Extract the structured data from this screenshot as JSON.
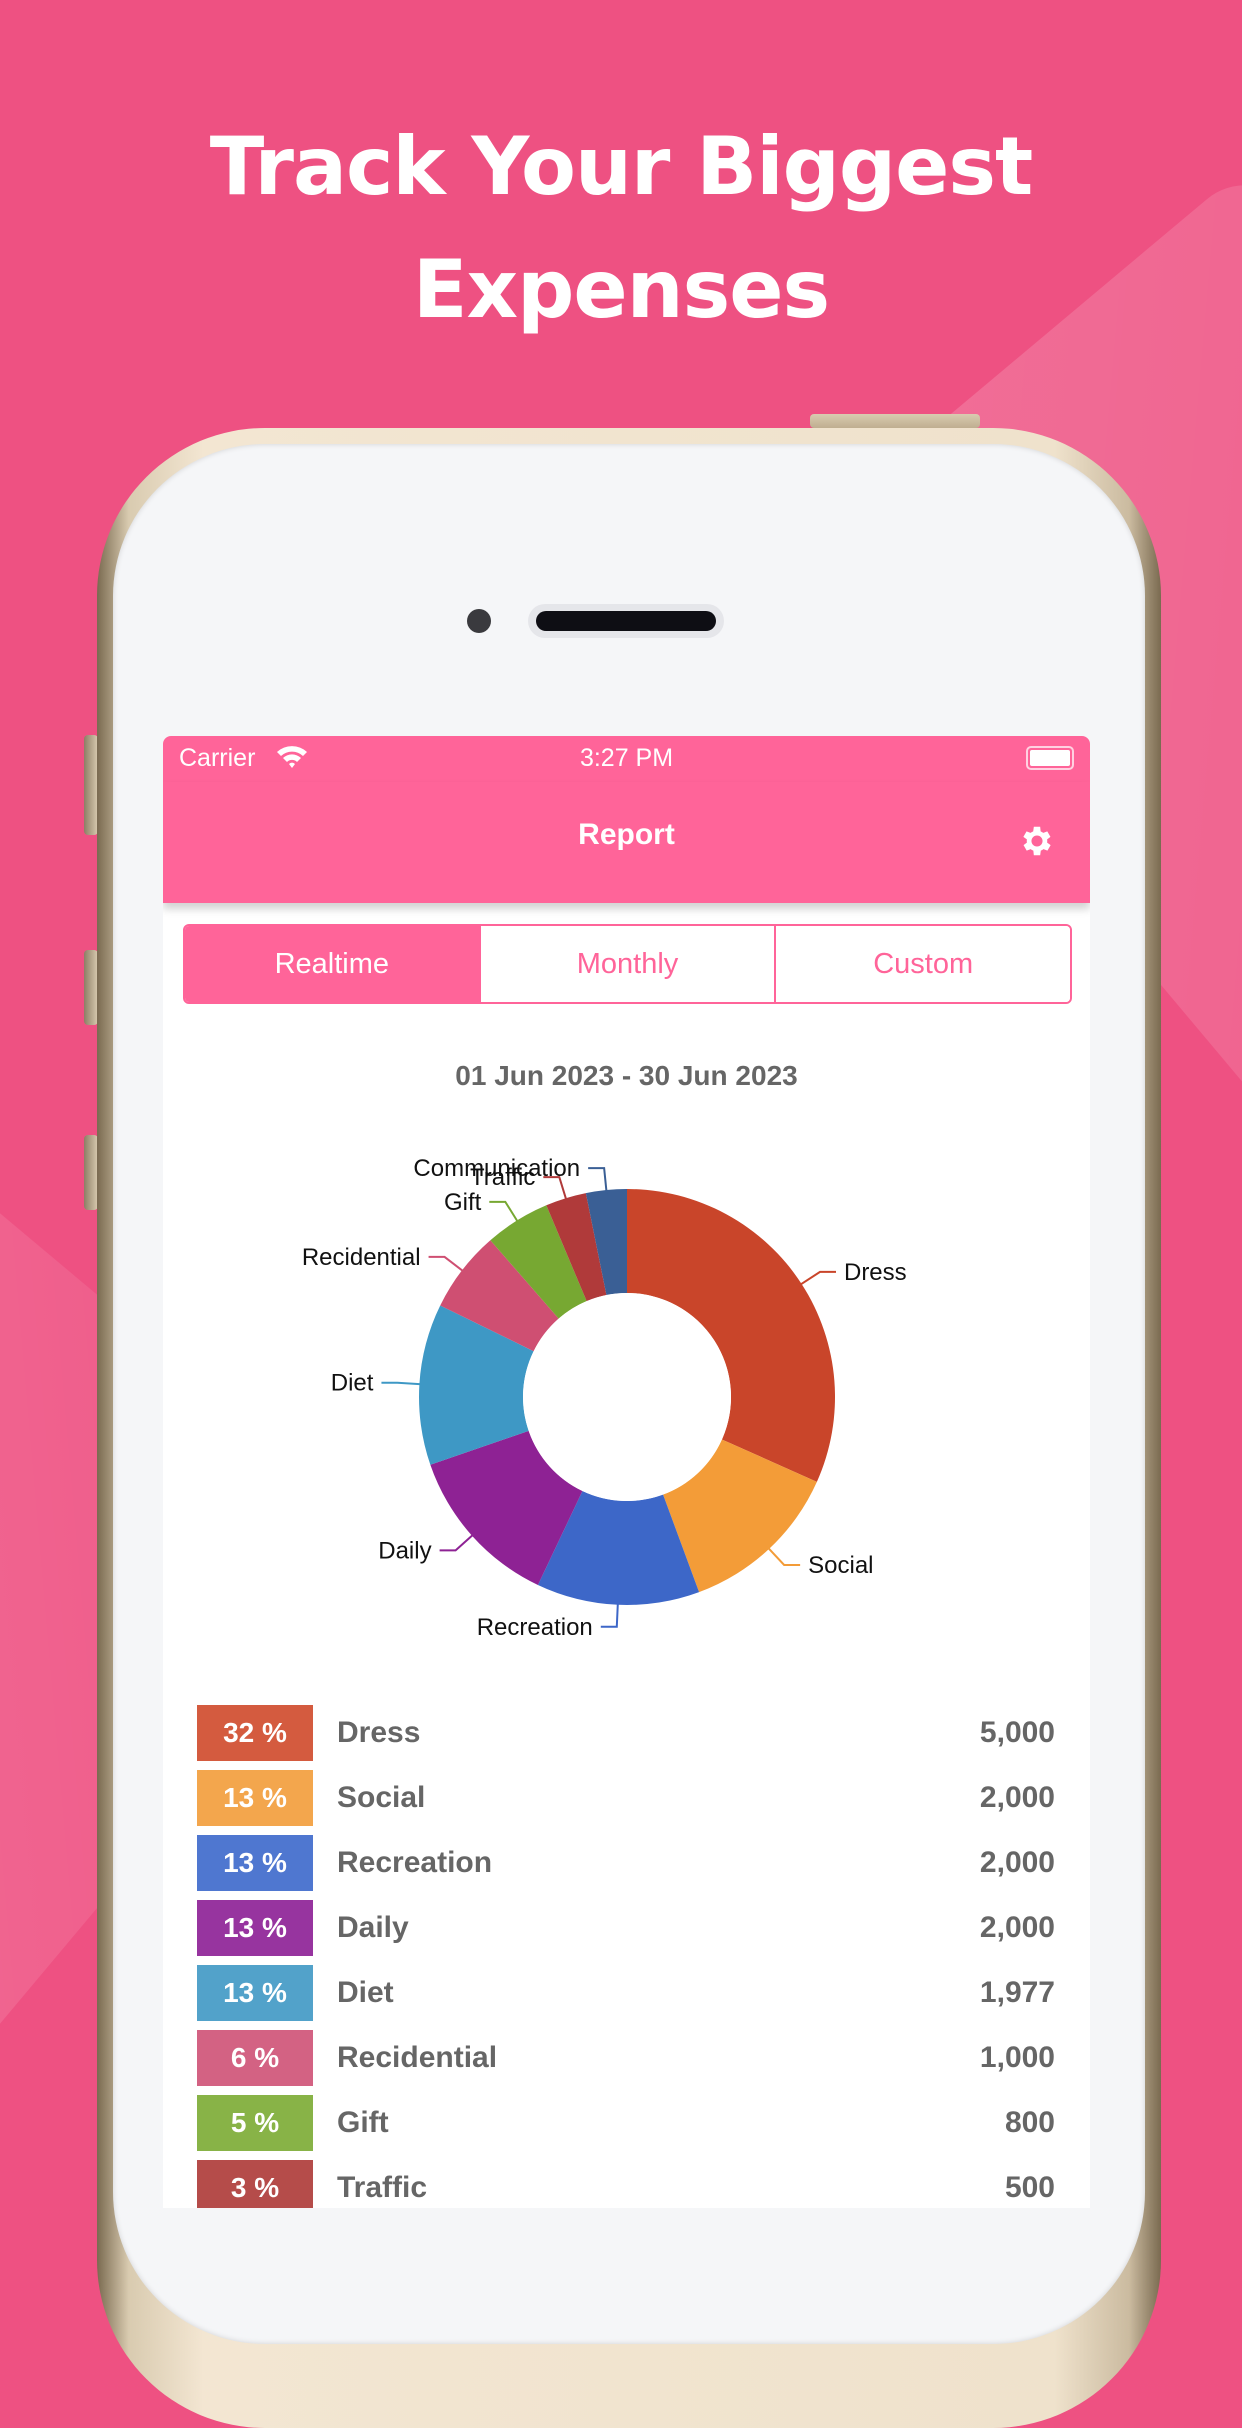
{
  "headline": {
    "line1": "Track Your Biggest",
    "line2": "Expenses"
  },
  "status_bar": {
    "carrier": "Carrier",
    "time": "3:27 PM",
    "wifi_icon": "wifi-icon",
    "battery_icon": "battery-icon"
  },
  "nav": {
    "title": "Report",
    "settings_icon": "gear-icon"
  },
  "tabs": [
    {
      "label": "Realtime",
      "active": true
    },
    {
      "label": "Monthly",
      "active": false
    },
    {
      "label": "Custom",
      "active": false
    }
  ],
  "date_range": "01 Jun 2023 - 30 Jun 2023",
  "colors": {
    "accent": "#FF6499",
    "background": "#EE5182"
  },
  "chart_data": {
    "type": "pie",
    "donut": true,
    "categories": [
      "Dress",
      "Social",
      "Recreation",
      "Daily",
      "Diet",
      "Recidential",
      "Gift",
      "Traffic",
      "Communication"
    ],
    "values": [
      5000,
      2000,
      2000,
      2000,
      1977,
      1000,
      800,
      500,
      500
    ],
    "colors": [
      "#C9452A",
      "#F39C38",
      "#3D67C8",
      "#8E2294",
      "#3E98C5",
      "#CF4F72",
      "#77A832",
      "#B03A3A",
      "#3A5F95"
    ]
  },
  "list": [
    {
      "percent": "32 %",
      "label": "Dress",
      "amount": "5,000",
      "color": "#D45B3F"
    },
    {
      "percent": "13 %",
      "label": "Social",
      "amount": "2,000",
      "color": "#F3A64D"
    },
    {
      "percent": "13 %",
      "label": "Recreation",
      "amount": "2,000",
      "color": "#4F77D0"
    },
    {
      "percent": "13 %",
      "label": "Daily",
      "amount": "2,000",
      "color": "#97349F"
    },
    {
      "percent": "13 %",
      "label": "Diet",
      "amount": "1,977",
      "color": "#52A2CA"
    },
    {
      "percent": "6 %",
      "label": "Recidential",
      "amount": "1,000",
      "color": "#D36283"
    },
    {
      "percent": "5 %",
      "label": "Gift",
      "amount": "800",
      "color": "#88B347"
    },
    {
      "percent": "3 %",
      "label": "Traffic",
      "amount": "500",
      "color": "#B54C4A"
    }
  ]
}
